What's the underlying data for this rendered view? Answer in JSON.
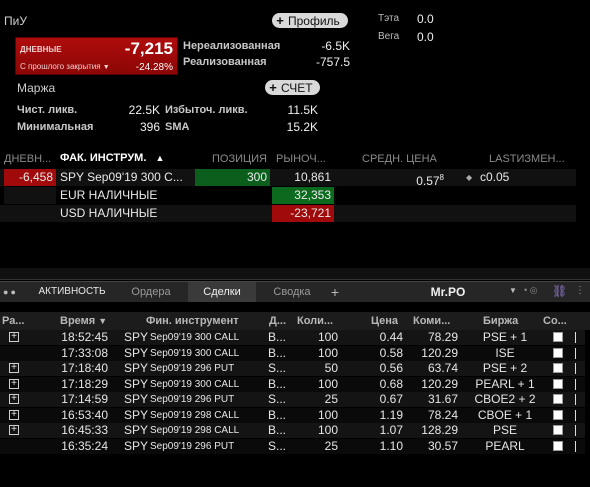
{
  "pnl": {
    "title": "ПиУ",
    "profile_button": "Профиль",
    "daily_label": "ДНЕВНЫЕ",
    "daily_value": "-7,215",
    "since_close_label": "С прошлого закрытия",
    "since_close_pct": "-24.28%",
    "unrealized_label": "Нереализованная",
    "unrealized_value": "-6.5K",
    "realized_label": "Реализованная",
    "realized_value": "-757.5"
  },
  "greeks": {
    "theta_label": "Тэта",
    "theta_value": "0.0",
    "vega_label": "Вега",
    "vega_value": "0.0"
  },
  "margin": {
    "title": "Маржа",
    "account_button": "СЧЕТ",
    "net_liq_label": "Чист. ликв.",
    "net_liq_value": "22.5K",
    "excess_liq_label": "Избыточ. ликв.",
    "excess_liq_value": "11.5K",
    "min_label": "Минимальная",
    "min_value": "396",
    "sma_label": "SMA",
    "sma_value": "15.2K"
  },
  "positions": {
    "headers": {
      "daily": "ДНЕВН...",
      "instrument": "ФАК. ИНСТРУМ.",
      "sort_icon": "▲",
      "position": "ПОЗИЦИЯ",
      "market": "РЫНОЧ...",
      "avg_price": "СРЕДН. ЦЕНА",
      "last_change": "LASTИЗМЕН..."
    },
    "rows": [
      {
        "daily": "-6,458",
        "instrument": "SPY Sep09'19 300 C...",
        "position": "300",
        "market": "10,861",
        "avg_price": "0.57",
        "avg_sup": "8",
        "last_change": "c0.05"
      },
      {
        "daily": "",
        "instrument": "EUR НАЛИЧНЫЕ",
        "position": "",
        "market": "32,353",
        "avg_price": "",
        "avg_sup": "",
        "last_change": ""
      },
      {
        "daily": "",
        "instrument": "USD НАЛИЧНЫЕ",
        "position": "",
        "market": "-23,721",
        "avg_price": "",
        "avg_sup": "",
        "last_change": ""
      }
    ]
  },
  "trades_panel": {
    "tabs": [
      "АКТИВНОСТЬ",
      "Ордера",
      "Сделки",
      "Сводка"
    ],
    "add_tab": "+",
    "panel_name": "Mr.PO",
    "headers": [
      "Ра...",
      "Время",
      "Фин. инструмент",
      "Д...",
      "Коли...",
      "Цена",
      "Коми...",
      "Биржа",
      "Со..."
    ],
    "rows": [
      {
        "expand": true,
        "time": "18:52:45",
        "sym": "SPY",
        "exp": "Sep09'19 300 CALL",
        "side": "B...",
        "qty": "100",
        "price": "0.44",
        "comm": "78.29",
        "exch": "PSE + 1"
      },
      {
        "expand": false,
        "time": "17:33:08",
        "sym": "SPY",
        "exp": "Sep09'19 300 CALL",
        "side": "B...",
        "qty": "100",
        "price": "0.58",
        "comm": "120.29",
        "exch": "ISE"
      },
      {
        "expand": true,
        "time": "17:18:40",
        "sym": "SPY",
        "exp": "Sep09'19 296 PUT",
        "side": "S...",
        "qty": "50",
        "price": "0.56",
        "comm": "63.74",
        "exch": "PSE + 2"
      },
      {
        "expand": true,
        "time": "17:18:29",
        "sym": "SPY",
        "exp": "Sep09'19 300 CALL",
        "side": "B...",
        "qty": "100",
        "price": "0.68",
        "comm": "120.29",
        "exch": "PEARL + 1"
      },
      {
        "expand": true,
        "time": "17:14:59",
        "sym": "SPY",
        "exp": "Sep09'19 296 PUT",
        "side": "S...",
        "qty": "25",
        "price": "0.67",
        "comm": "31.67",
        "exch": "CBOE2 + 2"
      },
      {
        "expand": true,
        "time": "16:53:40",
        "sym": "SPY",
        "exp": "Sep09'19 298 CALL",
        "side": "B...",
        "qty": "100",
        "price": "1.19",
        "comm": "78.24",
        "exch": "CBOE + 1"
      },
      {
        "expand": true,
        "time": "16:45:33",
        "sym": "SPY",
        "exp": "Sep09'19 298 CALL",
        "side": "B...",
        "qty": "100",
        "price": "1.07",
        "comm": "128.29",
        "exch": "PSE"
      },
      {
        "expand": false,
        "time": "16:35:24",
        "sym": "SPY",
        "exp": "Sep09'19 296 PUT",
        "side": "S...",
        "qty": "25",
        "price": "1.10",
        "comm": "30.57",
        "exch": "PEARL"
      }
    ]
  },
  "colors": {
    "negative_bg": "#a00a0a",
    "positive_bg": "#0b5e1c",
    "positive_cell": "#0c6a1e"
  }
}
